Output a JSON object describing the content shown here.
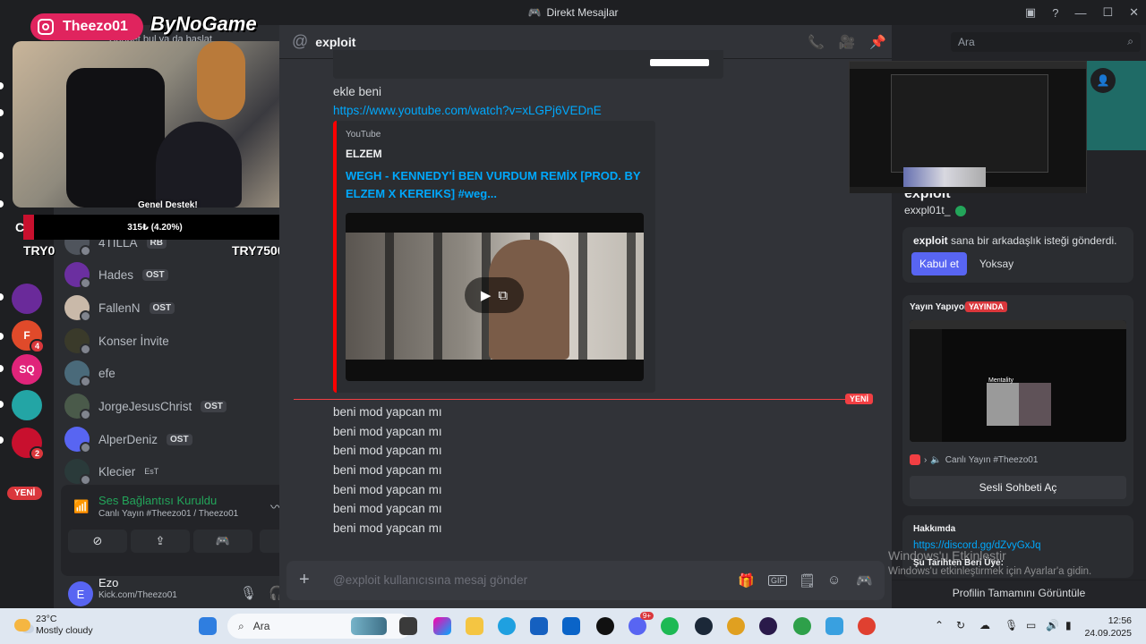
{
  "window": {
    "title": "Direkt Mesajlar"
  },
  "overlay": {
    "instagram": "Theezo01",
    "brand": "ByNoGame",
    "behind_text": "Sohbet bul ya da başlat",
    "goal_label": "Genel Destek!",
    "goal_progress": "315₺ (4.20%)",
    "goal_fraction": 0.042,
    "goal_min": "TRY0",
    "goal_max": "TRY7500",
    "goal_prefix": "C"
  },
  "dm_list": [
    {
      "name": "4TILLA",
      "tag": "RB",
      "color": "#4f545c"
    },
    {
      "name": "Hades",
      "tag": "OST",
      "color": "#6b2fa0"
    },
    {
      "name": "FallenN",
      "tag": "OST",
      "color": "#c9b9a9"
    },
    {
      "name": "Konser İnvite",
      "tag": "",
      "color": "#3a3a2a"
    },
    {
      "name": "efe",
      "tag": "",
      "color": "#4a6a7a"
    },
    {
      "name": "JorgeJesusChrist",
      "tag": "OST",
      "color": "#4a5a4a"
    },
    {
      "name": "AlperDeniz",
      "tag": "OST",
      "color": "#5865f2"
    },
    {
      "name": "Klecier",
      "tag": "EsT",
      "color": "#2a3a3a"
    }
  ],
  "servers": [
    {
      "label": "",
      "color": "#2b2d31",
      "badge": ""
    },
    {
      "label": "",
      "color": "#6a2a9a",
      "badge": ""
    },
    {
      "label": "F",
      "color": "#e04a2a",
      "badge": "4"
    },
    {
      "label": "SQ",
      "color": "#e0247a",
      "badge": ""
    },
    {
      "label": "",
      "color": "#23a5a5",
      "badge": ""
    },
    {
      "label": "",
      "color": "#c8102e",
      "badge": "2"
    }
  ],
  "rail_new": "YENİ",
  "voice": {
    "status": "Ses Bağlantısı Kuruldu",
    "channel": "Canlı Yayın #Theezo01 / Theezo01"
  },
  "user": {
    "name": "Ezo",
    "status": "Kick.com/Theezo01",
    "initial": "E"
  },
  "chat": {
    "recipient": "exploit",
    "messages": [
      {
        "type": "text",
        "text": "ekle beni"
      },
      {
        "type": "link",
        "text": "https://www.youtube.com/watch?v=xLGPj6VEDnE"
      }
    ],
    "embed": {
      "provider": "YouTube",
      "author": "ELZEM",
      "title": "WEGH - KENNEDY'İ BEN VURDUM REMİX [PROD. BY ELZEM X KEREIKS] #weg..."
    },
    "new_label": "YENİ",
    "repeated": [
      "beni mod yapcan mı",
      "beni mod yapcan mı",
      "beni mod yapcan mı",
      "beni mod yapcan mı",
      "beni mod yapcan mı",
      "beni mod yapcan mı",
      "beni mod yapcan mı"
    ],
    "placeholder": "@exploit kullanıcısına mesaj gönder"
  },
  "profile": {
    "search_placeholder": "Ara",
    "display_name": "exploit",
    "handle": "exxpl01t_",
    "friend_request_name": "exploit",
    "friend_request_text": "sana bir arkadaşlık isteği gönderdi.",
    "accept": "Kabul et",
    "decline": "Yoksay",
    "streaming_label": "Yayın Yapıyor",
    "live_badge": "YAYINDA",
    "stream_thumb_text": "Mentality",
    "stream_channel": "Canlı Yayın #Theezo01",
    "join_voice": "Sesli Sohbeti Aç",
    "about_header": "Hakkımda",
    "about_link": "https://discord.gg/dZvyGxJq",
    "member_since": "Şu Tarihten Beri Üye:",
    "full_profile": "Profilin Tamamını Görüntüle"
  },
  "watermark": {
    "line1": "Windows'u Etkinleştir",
    "line2": "Windows'u etkinleştirmek için Ayarlar'a gidin."
  },
  "taskbar": {
    "temp": "23°C",
    "weather": "Mostly cloudy",
    "search": "Ara",
    "time": "12:56",
    "date": "24.09.2025",
    "discord_badge": "9+"
  }
}
